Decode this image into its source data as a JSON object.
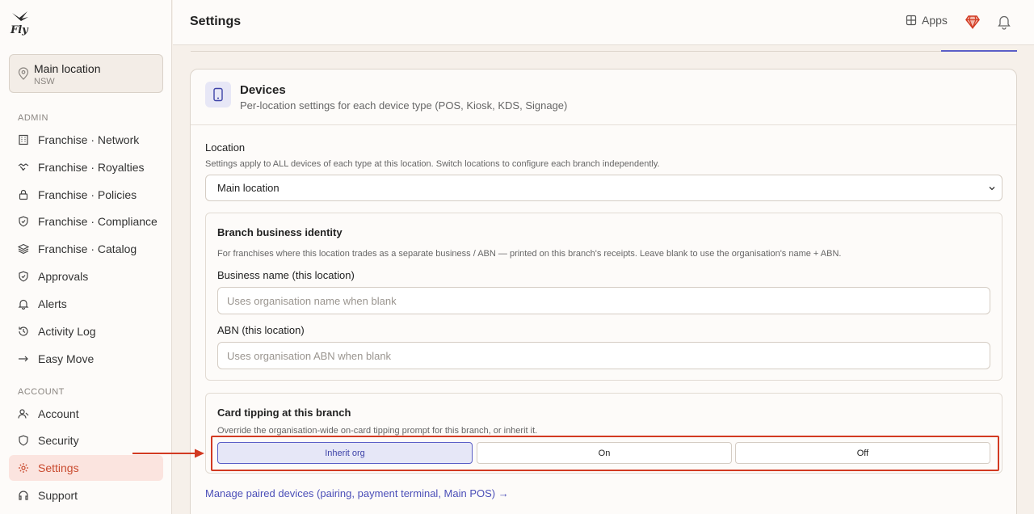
{
  "brand": {
    "logo_text": "Fly",
    "accent": "#c94a2e",
    "primary": "#5b5fc7",
    "annotation": "#d23a22"
  },
  "location_card": {
    "name": "Main location",
    "region": "NSW"
  },
  "sidebar": {
    "admin_label": "ADMIN",
    "admin_items": [
      {
        "label": "Franchise · Network",
        "icon": "building-icon"
      },
      {
        "label": "Franchise · Royalties",
        "icon": "handshake-icon"
      },
      {
        "label": "Franchise · Policies",
        "icon": "lock-icon"
      },
      {
        "label": "Franchise · Compliance",
        "icon": "shield-icon"
      },
      {
        "label": "Franchise · Catalog",
        "icon": "layers-icon"
      },
      {
        "label": "Approvals",
        "icon": "shield-check-icon"
      },
      {
        "label": "Alerts",
        "icon": "bell-icon"
      },
      {
        "label": "Activity Log",
        "icon": "history-icon"
      },
      {
        "label": "Easy Move",
        "icon": "arrow-right-icon"
      }
    ],
    "account_label": "ACCOUNT",
    "account_items": [
      {
        "label": "Account",
        "icon": "user-icon"
      },
      {
        "label": "Security",
        "icon": "shield-icon"
      },
      {
        "label": "Settings",
        "icon": "gear-icon",
        "active": true
      },
      {
        "label": "Support",
        "icon": "headset-icon"
      }
    ]
  },
  "topbar": {
    "title": "Settings",
    "apps_label": "Apps"
  },
  "devices": {
    "title": "Devices",
    "subtitle": "Per-location settings for each device type (POS, Kiosk, KDS, Signage)",
    "location_label": "Location",
    "location_help": "Settings apply to ALL devices of each type at this location. Switch locations to configure each branch independently.",
    "location_value": "Main location",
    "branch_identity": {
      "title": "Branch business identity",
      "help": "For franchises where this location trades as a separate business / ABN — printed on this branch's receipts. Leave blank to use the organisation's name + ABN.",
      "business_name_label": "Business name (this location)",
      "business_name_placeholder": "Uses organisation name when blank",
      "business_name_value": "",
      "abn_label": "ABN (this location)",
      "abn_placeholder": "Uses organisation ABN when blank",
      "abn_value": ""
    },
    "card_tipping": {
      "title": "Card tipping at this branch",
      "help": "Override the organisation-wide on-card tipping prompt for this branch, or inherit it.",
      "options": [
        "Inherit org",
        "On",
        "Off"
      ],
      "selected": "Inherit org"
    },
    "manage_link": "Manage paired devices (pairing, payment terminal, Main POS) →"
  }
}
